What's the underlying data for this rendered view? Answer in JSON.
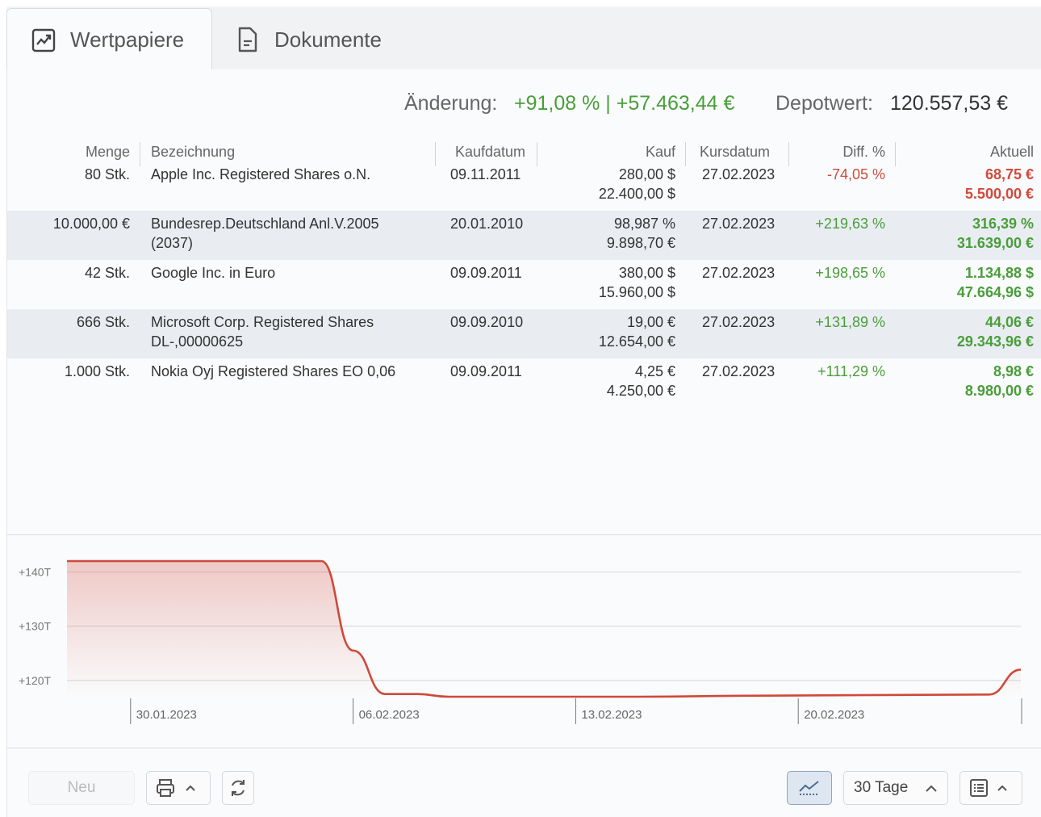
{
  "tabs": [
    {
      "label": "Wertpapiere",
      "icon": "trend-chart-icon",
      "active": true
    },
    {
      "label": "Dokumente",
      "icon": "document-icon",
      "active": false
    }
  ],
  "summary": {
    "change_label": "Änderung:",
    "change_value": "+91,08 % | +57.463,44 €",
    "depot_label": "Depotwert:",
    "depot_value": "120.557,53 €"
  },
  "table": {
    "headers": {
      "menge": "Menge",
      "bezeichnung": "Bezeichnung",
      "kaufdatum": "Kaufdatum",
      "kauf": "Kauf",
      "kursdatum": "Kursdatum",
      "diff": "Diff. %",
      "aktuell": "Aktuell"
    },
    "rows": [
      {
        "menge": "80 Stk.",
        "name1": "Apple Inc. Registered Shares o.N.",
        "name2": "",
        "kaufdatum": "09.11.2011",
        "kauf1": "280,00 $",
        "kauf2": "22.400,00 $",
        "kursdatum": "27.02.2023",
        "diff": "-74,05 %",
        "akt1": "68,75 €",
        "akt2": "5.500,00 €",
        "trend": "negative"
      },
      {
        "menge": "10.000,00 €",
        "name1": "Bundesrep.Deutschland Anl.V.2005",
        "name2": "(2037)",
        "kaufdatum": "20.01.2010",
        "kauf1": "98,987 %",
        "kauf2": "9.898,70 €",
        "kursdatum": "27.02.2023",
        "diff": "+219,63 %",
        "akt1": "316,39 %",
        "akt2": "31.639,00 €",
        "trend": "positive"
      },
      {
        "menge": "42 Stk.",
        "name1": "Google Inc. in Euro",
        "name2": "",
        "kaufdatum": "09.09.2011",
        "kauf1": "380,00 $",
        "kauf2": "15.960,00 $",
        "kursdatum": "27.02.2023",
        "diff": "+198,65 %",
        "akt1": "1.134,88 $",
        "akt2": "47.664,96 $",
        "trend": "positive"
      },
      {
        "menge": "666 Stk.",
        "name1": "Microsoft Corp. Registered Shares",
        "name2": "DL-,00000625",
        "kaufdatum": "09.09.2010",
        "kauf1": "19,00 €",
        "kauf2": "12.654,00 €",
        "kursdatum": "27.02.2023",
        "diff": "+131,89 %",
        "akt1": "44,06 €",
        "akt2": "29.343,96 €",
        "trend": "positive"
      },
      {
        "menge": "1.000 Stk.",
        "name1": "Nokia Oyj Registered Shares EO 0,06",
        "name2": "",
        "kaufdatum": "09.09.2011",
        "kauf1": "4,25 €",
        "kauf2": "4.250,00 €",
        "kursdatum": "27.02.2023",
        "diff": "+111,29 %",
        "akt1": "8,98 €",
        "akt2": "8.980,00 €",
        "trend": "positive"
      }
    ]
  },
  "chart_data": {
    "type": "area",
    "y_tick_labels": [
      "+140T",
      "+130T",
      "+120T"
    ],
    "y_ticks": [
      140,
      130,
      120
    ],
    "ylim": [
      117,
      142
    ],
    "x_tick_labels": [
      "30.01.2023",
      "06.02.2023",
      "13.02.2023",
      "20.02.2023"
    ],
    "x_ticks": [
      "2023-01-30",
      "2023-02-06",
      "2023-02-13",
      "2023-02-20"
    ],
    "xlim": [
      "2023-01-28",
      "2023-02-27"
    ],
    "series": [
      {
        "x": [
          "2023-01-28",
          "2023-02-05",
          "2023-02-06",
          "2023-02-07",
          "2023-02-08",
          "2023-02-09",
          "2023-02-15",
          "2023-02-19",
          "2023-02-26",
          "2023-02-27"
        ],
        "y": [
          142.0,
          142.0,
          125.5,
          117.5,
          117.5,
          117.0,
          117.0,
          117.2,
          117.4,
          122.0
        ]
      }
    ],
    "line_color": "#d0483a",
    "grid": true
  },
  "bottom": {
    "neu_label": "Neu",
    "range_label": "30 Tage",
    "print_icon": "printer-icon",
    "refresh_icon": "refresh-icon",
    "chart_toggle_icon": "line-chart-icon",
    "view_icon": "list-view-icon"
  }
}
